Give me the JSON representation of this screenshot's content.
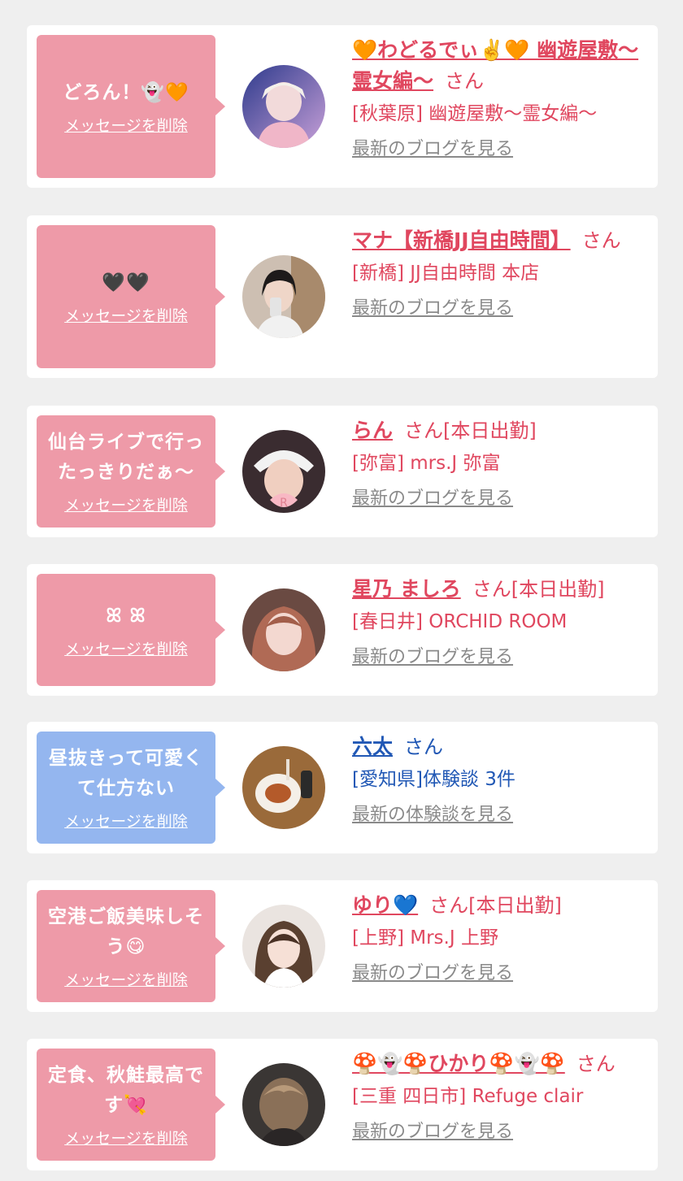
{
  "delete_label": "メッセージを削除",
  "cards": [
    {
      "message": "どろん！👻🧡",
      "name": "🧡わどるでぃ✌️🧡 幽遊屋敷〜霊女編〜",
      "suffix": "さん",
      "shop": "[秋葉原] 幽遊屋敷〜霊女編〜",
      "link": "最新のブログを見る",
      "theme": "pink"
    },
    {
      "message": "🖤🖤",
      "name": "マナ【新橋JJ自由時間】",
      "suffix": "さん",
      "shop": "[新橋] JJ自由時間 本店",
      "link": "最新のブログを見る",
      "theme": "pink"
    },
    {
      "message": "仙台ライブで行ったっきりだぁ〜",
      "name": "らん",
      "suffix": "さん[本日出勤]",
      "shop": "[弥富] mrs.J 弥富",
      "link": "最新のブログを見る",
      "theme": "pink"
    },
    {
      "message": "ꕤ ꕤ",
      "name": "星乃 ましろ",
      "suffix": "さん[本日出勤]",
      "shop": "[春日井] ORCHID ROOM",
      "link": "最新のブログを見る",
      "theme": "pink"
    },
    {
      "message": "昼抜きって可愛くて仕方ない",
      "name": "六太",
      "suffix": "さん",
      "shop": "[愛知県]体験談 3件",
      "link": "最新の体験談を見る",
      "theme": "blue"
    },
    {
      "message": "空港ご飯美味しそう😋",
      "name": "ゆり💙",
      "suffix": "さん[本日出勤]",
      "shop": "[上野] Mrs.J 上野",
      "link": "最新のブログを見る",
      "theme": "pink"
    },
    {
      "message": "定食、秋鮭最高です💘",
      "name": "🍄👻🍄ひかり🍄👻🍄",
      "suffix": "さん",
      "shop": "[三重 四日市] Refuge clair",
      "link": "最新のブログを見る",
      "theme": "pink"
    }
  ],
  "colors": {
    "background": "#efefef",
    "bubble_pink": "#ee9aa8",
    "bubble_blue": "#94b6ef",
    "name_pink": "#e0475f",
    "name_blue": "#2158b5",
    "link_gray": "#8a8a8a"
  }
}
